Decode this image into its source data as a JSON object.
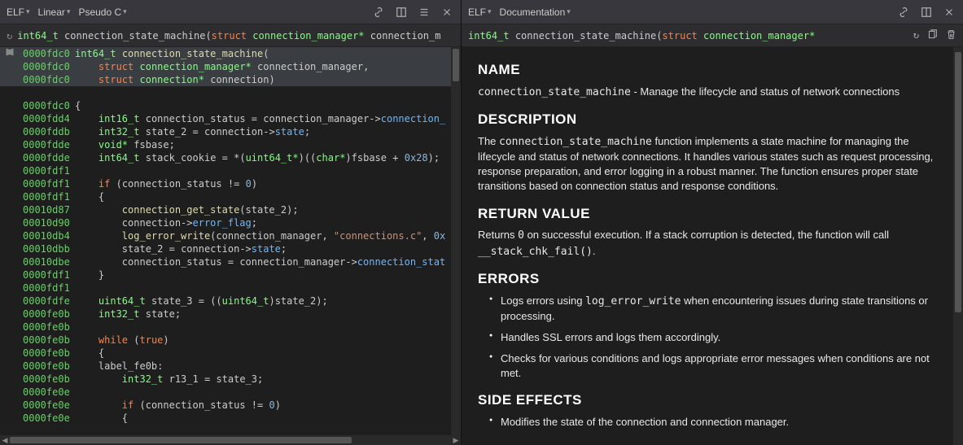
{
  "left": {
    "toolbar": {
      "d1": "ELF",
      "d2": "Linear",
      "d3": "Pseudo C"
    },
    "signature": {
      "ret": "int64_t",
      "name": "connection_state_machine",
      "kw": "struct",
      "type": "connection_manager*",
      "arg": "connection_m"
    },
    "code": [
      {
        "addr": "0000fdc0",
        "icon": "book",
        "hl": true,
        "html": "<span class='tk-type'>int64_t</span> <span class='tk-func'>connection_state_machine</span><span class='tk-punc'>(</span>"
      },
      {
        "addr": "0000fdc0",
        "hl": true,
        "html": "    <span class='tk-kw'>struct</span> <span class='tk-type'>connection_manager*</span> <span class='tk-var'>connection_manager</span><span class='tk-punc'>,</span>"
      },
      {
        "addr": "0000fdc0",
        "hl": true,
        "html": "    <span class='tk-kw'>struct</span> <span class='tk-type'>connection*</span> <span class='tk-var'>connection</span><span class='tk-punc'>)</span>"
      },
      {
        "addr": "",
        "html": ""
      },
      {
        "addr": "0000fdc0",
        "html": "<span class='tk-punc'>{</span>"
      },
      {
        "addr": "0000fdd4",
        "html": "    <span class='tk-type'>int16_t</span> <span class='tk-var'>connection_status</span> <span class='tk-punc'>=</span> <span class='tk-var'>connection_manager</span><span class='tk-punc'>-&gt;</span><span class='tk-field'>connection_</span>"
      },
      {
        "addr": "0000fddb",
        "html": "    <span class='tk-type'>int32_t</span> <span class='tk-var'>state_2</span> <span class='tk-punc'>=</span> <span class='tk-var'>connection</span><span class='tk-punc'>-&gt;</span><span class='tk-field'>state</span><span class='tk-punc'>;</span>"
      },
      {
        "addr": "0000fdde",
        "html": "    <span class='tk-type'>void*</span> <span class='tk-var'>fsbase</span><span class='tk-punc'>;</span>"
      },
      {
        "addr": "0000fdde",
        "html": "    <span class='tk-type'>int64_t</span> <span class='tk-var'>stack_cookie</span> <span class='tk-punc'>=</span> <span class='tk-punc'>*(</span><span class='tk-type'>uint64_t*</span><span class='tk-punc'>)((</span><span class='tk-type'>char*</span><span class='tk-punc'>)</span><span class='tk-var'>fsbase</span> <span class='tk-punc'>+</span> <span class='tk-num'>0x28</span><span class='tk-punc'>);</span>"
      },
      {
        "addr": "0000fdf1",
        "html": ""
      },
      {
        "addr": "0000fdf1",
        "html": "    <span class='tk-kw'>if</span> <span class='tk-punc'>(</span><span class='tk-var'>connection_status</span> <span class='tk-punc'>!=</span> <span class='tk-num'>0</span><span class='tk-punc'>)</span>"
      },
      {
        "addr": "0000fdf1",
        "html": "    <span class='tk-punc'>{</span>"
      },
      {
        "addr": "00010d87",
        "html": "        <span class='tk-func'>connection_get_state</span><span class='tk-punc'>(</span><span class='tk-var'>state_2</span><span class='tk-punc'>);</span>"
      },
      {
        "addr": "00010d90",
        "html": "        <span class='tk-var'>connection</span><span class='tk-punc'>-&gt;</span><span class='tk-field'>error_flag</span><span class='tk-punc'>;</span>"
      },
      {
        "addr": "00010db4",
        "html": "        <span class='tk-func'>log_error_write</span><span class='tk-punc'>(</span><span class='tk-var'>connection_manager</span><span class='tk-punc'>,</span> <span class='tk-str'>\"connections.c\"</span><span class='tk-punc'>,</span> <span class='tk-num'>0x</span>"
      },
      {
        "addr": "00010dbb",
        "html": "        <span class='tk-var'>state_2</span> <span class='tk-punc'>=</span> <span class='tk-var'>connection</span><span class='tk-punc'>-&gt;</span><span class='tk-field'>state</span><span class='tk-punc'>;</span>"
      },
      {
        "addr": "00010dbe",
        "html": "        <span class='tk-var'>connection_status</span> <span class='tk-punc'>=</span> <span class='tk-var'>connection_manager</span><span class='tk-punc'>-&gt;</span><span class='tk-field'>connection_stat</span>"
      },
      {
        "addr": "0000fdf1",
        "html": "    <span class='tk-punc'>}</span>"
      },
      {
        "addr": "0000fdf1",
        "html": ""
      },
      {
        "addr": "0000fdfe",
        "html": "    <span class='tk-type'>uint64_t</span> <span class='tk-var'>state_3</span> <span class='tk-punc'>= ((</span><span class='tk-type'>uint64_t</span><span class='tk-punc'>)</span><span class='tk-var'>state_2</span><span class='tk-punc'>);</span>"
      },
      {
        "addr": "0000fe0b",
        "html": "    <span class='tk-type'>int32_t</span> <span class='tk-var'>state</span><span class='tk-punc'>;</span>"
      },
      {
        "addr": "0000fe0b",
        "html": ""
      },
      {
        "addr": "0000fe0b",
        "html": "    <span class='tk-kw'>while</span> <span class='tk-punc'>(</span><span class='tk-kw'>true</span><span class='tk-punc'>)</span>"
      },
      {
        "addr": "0000fe0b",
        "html": "    <span class='tk-punc'>{</span>"
      },
      {
        "addr": "0000fe0b",
        "html": "    <span class='tk-var'>label_fe0b</span><span class='tk-punc'>:</span>"
      },
      {
        "addr": "0000fe0b",
        "html": "        <span class='tk-type'>int32_t</span> <span class='tk-var'>r13_1</span> <span class='tk-punc'>=</span> <span class='tk-var'>state_3</span><span class='tk-punc'>;</span>"
      },
      {
        "addr": "0000fe0e",
        "html": ""
      },
      {
        "addr": "0000fe0e",
        "html": "        <span class='tk-kw'>if</span> <span class='tk-punc'>(</span><span class='tk-var'>connection_status</span> <span class='tk-punc'>!=</span> <span class='tk-num'>0</span><span class='tk-punc'>)</span>"
      },
      {
        "addr": "0000fe0e",
        "html": "        <span class='tk-punc'>{</span>"
      }
    ]
  },
  "right": {
    "toolbar": {
      "d1": "ELF",
      "d2": "Documentation"
    },
    "signature": {
      "ret": "int64_t",
      "name": "connection_state_machine",
      "kw": "struct",
      "type": "connection_manager*"
    },
    "doc": {
      "h_name": "NAME",
      "name_line_a": "connection_state_machine",
      "name_line_b": " - Manage the lifecycle and status of network connections",
      "h_desc": "DESCRIPTION",
      "desc_a": "The ",
      "desc_code": "connection_state_machine",
      "desc_b": " function implements a state machine for managing the lifecycle and status of network connections. It handles various states such as request processing, response preparation, and error logging in a robust manner. The function ensures proper state transitions based on connection status and response conditions.",
      "h_ret": "RETURN VALUE",
      "ret_a": "Returns ",
      "ret_code1": "0",
      "ret_b": " on successful execution. If a stack corruption is detected, the function will call ",
      "ret_code2": "__stack_chk_fail()",
      "ret_c": ".",
      "h_err": "ERRORS",
      "err1_a": "Logs errors using ",
      "err1_code": "log_error_write",
      "err1_b": " when encountering issues during state transitions or processing.",
      "err2": "Handles SSL errors and logs them accordingly.",
      "err3": "Checks for various conditions and logs appropriate error messages when conditions are not met.",
      "h_side": "SIDE EFFECTS",
      "side1": "Modifies the state of the connection and connection manager."
    }
  }
}
